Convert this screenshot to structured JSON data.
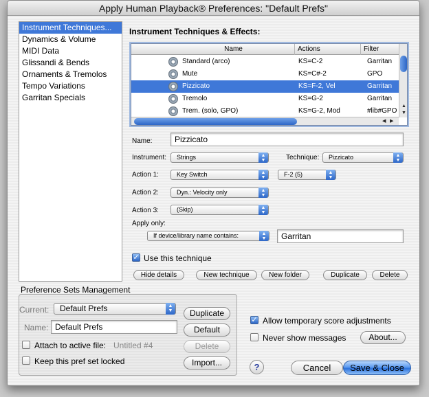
{
  "window": {
    "title": "Apply Human Playback® Preferences: \"Default Prefs\""
  },
  "categories": [
    {
      "label": "Instrument Techniques...",
      "selected": true
    },
    {
      "label": "Dynamics & Volume",
      "selected": false
    },
    {
      "label": "MIDI Data",
      "selected": false
    },
    {
      "label": "Glissandi & Bends",
      "selected": false
    },
    {
      "label": "Ornaments & Tremolos",
      "selected": false
    },
    {
      "label": "Tempo Variations",
      "selected": false
    },
    {
      "label": "Garritan Specials",
      "selected": false
    }
  ],
  "main": {
    "section_title": "Instrument Techniques & Effects:",
    "table": {
      "columns": [
        "Name",
        "Actions",
        "Filter"
      ],
      "rows": [
        {
          "name": "Standard (arco)",
          "actions": "KS=C-2",
          "filter": "Garritan",
          "selected": false
        },
        {
          "name": "Mute",
          "actions": "KS=C#-2",
          "filter": "GPO",
          "selected": false
        },
        {
          "name": "Pizzicato",
          "actions": "KS=F-2, Vel",
          "filter": "Garritan",
          "selected": true
        },
        {
          "name": "Tremolo",
          "actions": "KS=G-2",
          "filter": "Garritan",
          "selected": false
        },
        {
          "name": "Trem. (solo, GPO)",
          "actions": "KS=G-2, Mod",
          "filter": "#lib#GPO",
          "selected": false
        }
      ],
      "row_icon": "gear-icon"
    },
    "name_label": "Name:",
    "name_value": "Pizzicato",
    "instrument_label": "Instrument:",
    "instrument_value": "Strings",
    "technique_label": "Technique:",
    "technique_value": "Pizzicato",
    "action1_label": "Action 1:",
    "action1_value": "Key Switch",
    "action1_param": "F-2 (5)",
    "action2_label": "Action 2:",
    "action2_value": "Dyn.: Velocity only",
    "action3_label": "Action 3:",
    "action3_value": "(Skip)",
    "apply_only_label": "Apply only:",
    "apply_only_value": "If device/library name contains:",
    "apply_only_text": "Garritan",
    "use_technique_label": "Use this technique",
    "use_technique_checked": true,
    "buttons": {
      "hide_details": "Hide details",
      "new_technique": "New technique",
      "new_folder": "New folder",
      "duplicate": "Duplicate",
      "delete": "Delete"
    }
  },
  "prefsets": {
    "title": "Preference Sets Management",
    "current_label": "Current:",
    "current_value": "Default Prefs",
    "name_label": "Name:",
    "name_value": "Default Prefs",
    "attach_label": "Attach to active file:",
    "attach_file": "Untitled #4",
    "attach_checked": false,
    "lock_label": "Keep this pref set locked",
    "lock_checked": false,
    "buttons": {
      "duplicate": "Duplicate",
      "default": "Default",
      "delete": "Delete",
      "import": "Import..."
    }
  },
  "options": {
    "allow_temp_label": "Allow temporary score adjustments",
    "allow_temp_checked": true,
    "never_show_label": "Never show messages",
    "never_show_checked": false,
    "about_label": "About..."
  },
  "footer": {
    "help_label": "?",
    "cancel_label": "Cancel",
    "save_close_label": "Save & Close"
  },
  "colors": {
    "selection": "#3f78d8",
    "accent": "#2d72dc"
  }
}
